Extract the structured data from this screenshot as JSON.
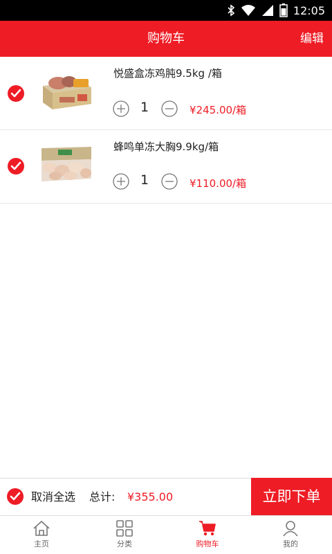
{
  "status_bar": {
    "time": "12:05"
  },
  "header": {
    "title": "购物车",
    "edit_label": "编辑"
  },
  "cart": {
    "items": [
      {
        "name": "悦盛盒冻鸡肫9.5kg /箱",
        "quantity": "1",
        "price": "¥245.00/箱",
        "checked": true
      },
      {
        "name": "蜂鸣单冻大胸9.9kg/箱",
        "quantity": "1",
        "price": "¥110.00/箱",
        "checked": true
      }
    ]
  },
  "checkout": {
    "deselect_all_label": "取消全选",
    "total_label": "总计:",
    "total_value": "¥355.00",
    "order_label": "立即下单"
  },
  "tabs": [
    {
      "label": "主页",
      "icon": "home-icon",
      "active": false
    },
    {
      "label": "分类",
      "icon": "category-grid-icon",
      "active": false
    },
    {
      "label": "购物车",
      "icon": "cart-icon",
      "active": true
    },
    {
      "label": "我的",
      "icon": "user-icon",
      "active": false
    }
  ],
  "colors": {
    "accent": "#ee1c25",
    "text": "#222222",
    "muted": "#666666"
  }
}
